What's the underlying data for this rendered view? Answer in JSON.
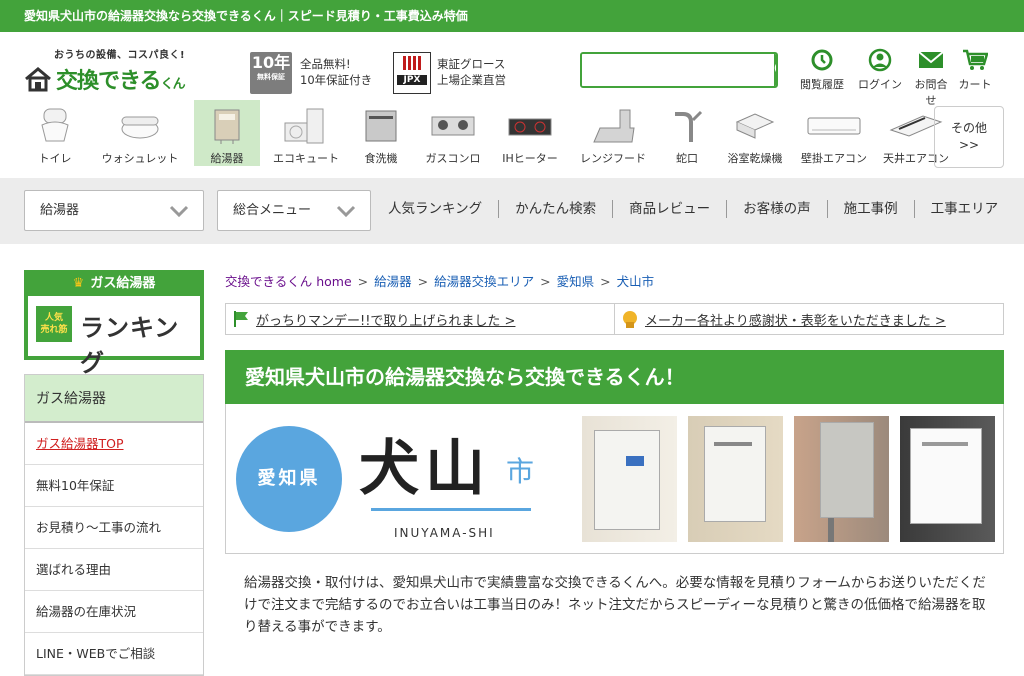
{
  "topbar": {
    "text": "愛知県犬山市の給湯器交換なら交換できるくん｜スピード見積り・工事費込み特価"
  },
  "logo": {
    "tagline": "おうちの設備、コスパ良く!",
    "name": "交換できる",
    "name_suffix": "くん"
  },
  "badges": {
    "warranty_year": "10年",
    "warranty_sub": "無料保証",
    "warranty_line1": "全品無料!",
    "warranty_line2": "10年保証付き",
    "jpx_label": "JPX",
    "jpx_line1": "東証グロース",
    "jpx_line2": "上場企業直営"
  },
  "search": {
    "placeholder": ""
  },
  "header_nav": [
    {
      "label": "閲覧履歴",
      "icon": "history-icon"
    },
    {
      "label": "ログイン",
      "icon": "user-icon"
    },
    {
      "label": "お問合せ",
      "icon": "mail-icon"
    },
    {
      "label": "カート",
      "icon": "cart-icon"
    }
  ],
  "categories": [
    {
      "label": "トイレ"
    },
    {
      "label": "ウォシュレット"
    },
    {
      "label": "給湯器"
    },
    {
      "label": "エコキュート"
    },
    {
      "label": "食洗機"
    },
    {
      "label": "ガスコンロ"
    },
    {
      "label": "IHヒーター"
    },
    {
      "label": "レンジフード"
    },
    {
      "label": "蛇口"
    },
    {
      "label": "浴室乾燥機"
    },
    {
      "label": "壁掛エアコン"
    },
    {
      "label": "天井エアコン"
    }
  ],
  "other": {
    "line1": "その他",
    "line2": ">>"
  },
  "menu": {
    "dropdown1": "給湯器",
    "dropdown2": "総合メニュー",
    "links": [
      "人気ランキング",
      "かんたん検索",
      "商品レビュー",
      "お客様の声",
      "施工事例",
      "工事エリア"
    ]
  },
  "ranking": {
    "title": "ガス給湯器",
    "hot_line1": "人気",
    "hot_line2": "売れ筋",
    "text": "ランキング"
  },
  "sidebar": {
    "heading": "ガス給湯器",
    "items": [
      "ガス給湯器TOP",
      "無料10年保証",
      "お見積り～工事の流れ",
      "選ばれる理由",
      "給湯器の在庫状況",
      "LINE・WEBでご相談"
    ]
  },
  "breadcrumb": [
    "交換できるくん home",
    "給湯器",
    "給湯器交換エリア",
    "愛知県",
    "犬山市"
  ],
  "notices": [
    "がっちりマンデー!!で取り上げられました >",
    "メーカー各社より感謝状・表彰をいただきました >"
  ],
  "banner": {
    "title": "愛知県犬山市の給湯器交換なら交換できるくん！"
  },
  "city": {
    "prefecture": "愛知県",
    "name": "犬山",
    "suffix": "市",
    "romaji": "INUYAMA-SHI"
  },
  "intro": {
    "text": "給湯器交換・取付けは、愛知県犬山市で実績豊富な交換できるくんへ。必要な情報を見積りフォームからお送りいただくだけで注文まで完結するのでお立合いは工事当日のみ！ネット注文だからスピーディーな見積りと驚きの低価格で給湯器を取り替える事ができます。"
  },
  "colors": {
    "brand_green": "#43a33b",
    "light_green": "#d3edcd",
    "city_blue": "#5aa6df"
  }
}
